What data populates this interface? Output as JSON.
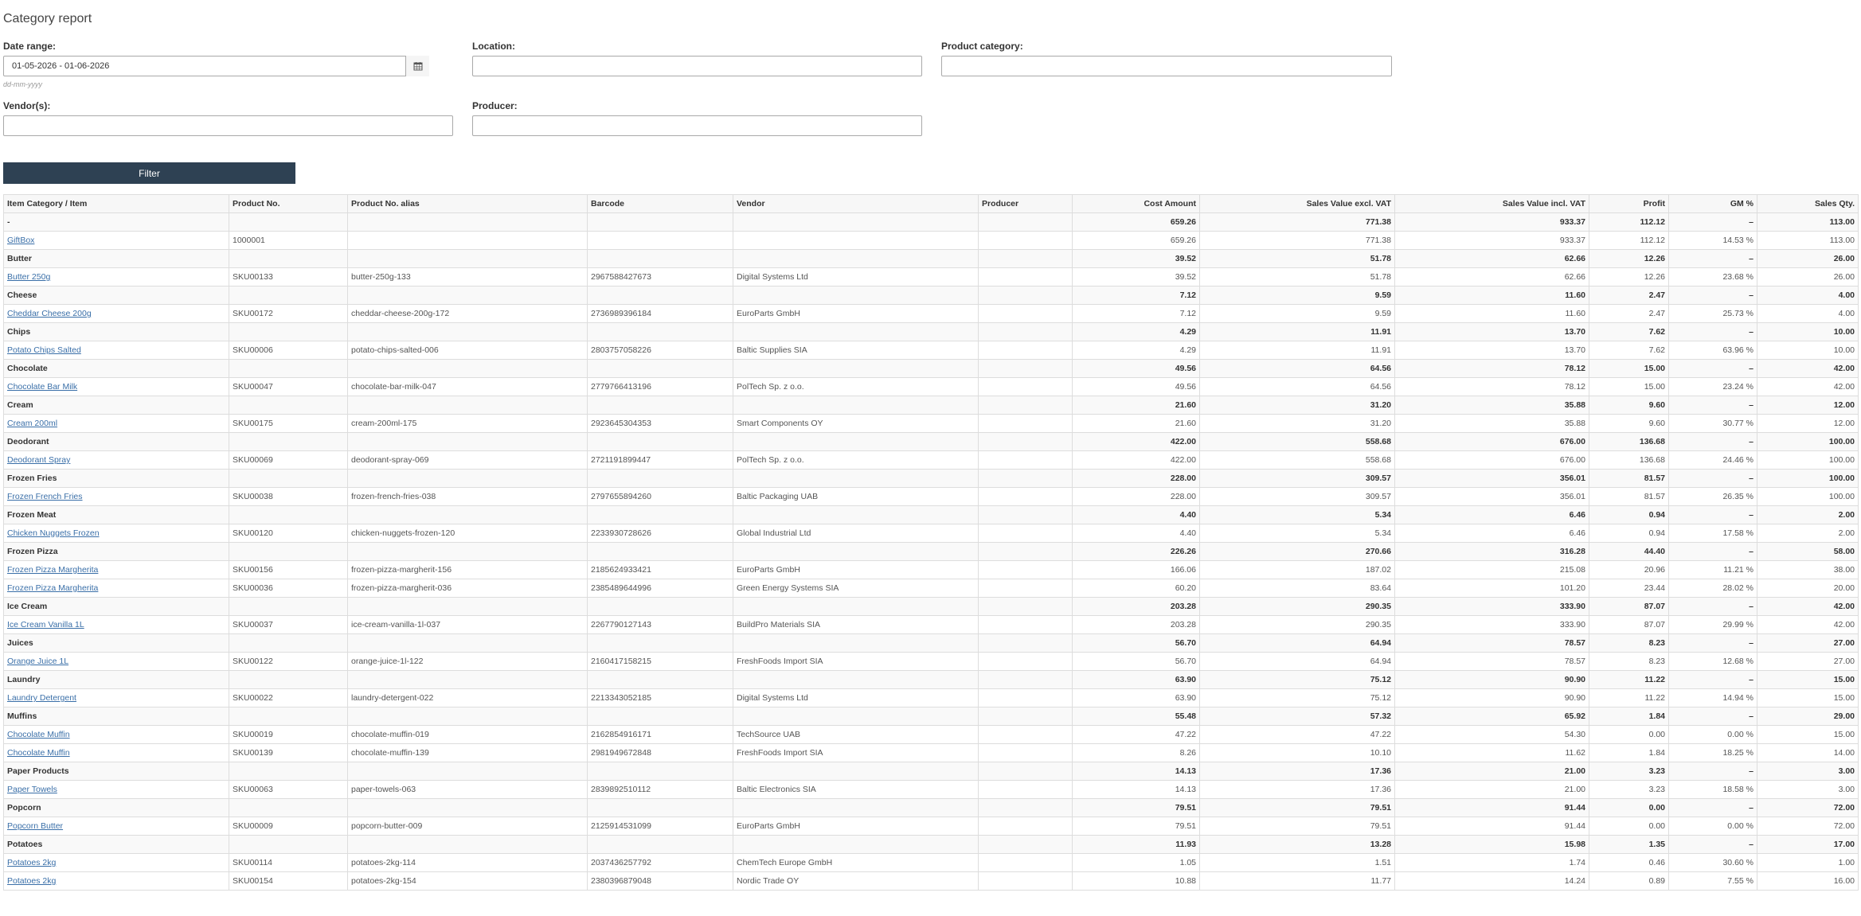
{
  "page": {
    "title": "Category report"
  },
  "filters": {
    "date_range": {
      "label": "Date range:",
      "value": "01-05-2026 - 01-06-2026",
      "hint": "dd-mm-yyyy"
    },
    "location": {
      "label": "Location:",
      "value": ""
    },
    "product_category": {
      "label": "Product category:",
      "value": ""
    },
    "vendors": {
      "label": "Vendor(s):",
      "value": ""
    },
    "producer": {
      "label": "Producer:",
      "value": ""
    },
    "filter_button": "Filter"
  },
  "table": {
    "columns": [
      "Item Category / Item",
      "Product No.",
      "Product No. alias",
      "Barcode",
      "Vendor",
      "Producer",
      "Cost Amount",
      "Sales Value excl. VAT",
      "Sales Value incl. VAT",
      "Profit",
      "GM %",
      "Sales Qty."
    ],
    "rows": [
      {
        "type": "category",
        "cells": [
          "-",
          "",
          "",
          "",
          "",
          "",
          "659.26",
          "771.38",
          "933.37",
          "112.12",
          "–",
          "113.00"
        ]
      },
      {
        "type": "item",
        "cells": [
          "GiftBox",
          "1000001",
          "",
          "",
          "",
          "",
          "659.26",
          "771.38",
          "933.37",
          "112.12",
          "14.53 %",
          "113.00"
        ]
      },
      {
        "type": "category",
        "cells": [
          "Butter",
          "",
          "",
          "",
          "",
          "",
          "39.52",
          "51.78",
          "62.66",
          "12.26",
          "–",
          "26.00"
        ]
      },
      {
        "type": "item",
        "cells": [
          "Butter 250g",
          "SKU00133",
          "butter-250g-133",
          "2967588427673",
          "Digital Systems Ltd",
          "",
          "39.52",
          "51.78",
          "62.66",
          "12.26",
          "23.68 %",
          "26.00"
        ]
      },
      {
        "type": "category",
        "cells": [
          "Cheese",
          "",
          "",
          "",
          "",
          "",
          "7.12",
          "9.59",
          "11.60",
          "2.47",
          "–",
          "4.00"
        ]
      },
      {
        "type": "item",
        "cells": [
          "Cheddar Cheese 200g",
          "SKU00172",
          "cheddar-cheese-200g-172",
          "2736989396184",
          "EuroParts GmbH",
          "",
          "7.12",
          "9.59",
          "11.60",
          "2.47",
          "25.73 %",
          "4.00"
        ]
      },
      {
        "type": "category",
        "cells": [
          "Chips",
          "",
          "",
          "",
          "",
          "",
          "4.29",
          "11.91",
          "13.70",
          "7.62",
          "–",
          "10.00"
        ]
      },
      {
        "type": "item",
        "cells": [
          "Potato Chips Salted",
          "SKU00006",
          "potato-chips-salted-006",
          "2803757058226",
          "Baltic Supplies SIA",
          "",
          "4.29",
          "11.91",
          "13.70",
          "7.62",
          "63.96 %",
          "10.00"
        ]
      },
      {
        "type": "category",
        "cells": [
          "Chocolate",
          "",
          "",
          "",
          "",
          "",
          "49.56",
          "64.56",
          "78.12",
          "15.00",
          "–",
          "42.00"
        ]
      },
      {
        "type": "item",
        "cells": [
          "Chocolate Bar Milk",
          "SKU00047",
          "chocolate-bar-milk-047",
          "2779766413196",
          "PolTech Sp. z o.o.",
          "",
          "49.56",
          "64.56",
          "78.12",
          "15.00",
          "23.24 %",
          "42.00"
        ]
      },
      {
        "type": "category",
        "cells": [
          "Cream",
          "",
          "",
          "",
          "",
          "",
          "21.60",
          "31.20",
          "35.88",
          "9.60",
          "–",
          "12.00"
        ]
      },
      {
        "type": "item",
        "cells": [
          "Cream 200ml",
          "SKU00175",
          "cream-200ml-175",
          "2923645304353",
          "Smart Components OY",
          "",
          "21.60",
          "31.20",
          "35.88",
          "9.60",
          "30.77 %",
          "12.00"
        ]
      },
      {
        "type": "category",
        "cells": [
          "Deodorant",
          "",
          "",
          "",
          "",
          "",
          "422.00",
          "558.68",
          "676.00",
          "136.68",
          "–",
          "100.00"
        ]
      },
      {
        "type": "item",
        "cells": [
          "Deodorant Spray",
          "SKU00069",
          "deodorant-spray-069",
          "2721191899447",
          "PolTech Sp. z o.o.",
          "",
          "422.00",
          "558.68",
          "676.00",
          "136.68",
          "24.46 %",
          "100.00"
        ]
      },
      {
        "type": "category",
        "cells": [
          "Frozen Fries",
          "",
          "",
          "",
          "",
          "",
          "228.00",
          "309.57",
          "356.01",
          "81.57",
          "–",
          "100.00"
        ]
      },
      {
        "type": "item",
        "cells": [
          "Frozen French Fries",
          "SKU00038",
          "frozen-french-fries-038",
          "2797655894260",
          "Baltic Packaging UAB",
          "",
          "228.00",
          "309.57",
          "356.01",
          "81.57",
          "26.35 %",
          "100.00"
        ]
      },
      {
        "type": "category",
        "cells": [
          "Frozen Meat",
          "",
          "",
          "",
          "",
          "",
          "4.40",
          "5.34",
          "6.46",
          "0.94",
          "–",
          "2.00"
        ]
      },
      {
        "type": "item",
        "cells": [
          "Chicken Nuggets Frozen",
          "SKU00120",
          "chicken-nuggets-frozen-120",
          "2233930728626",
          "Global Industrial Ltd",
          "",
          "4.40",
          "5.34",
          "6.46",
          "0.94",
          "17.58 %",
          "2.00"
        ]
      },
      {
        "type": "category",
        "cells": [
          "Frozen Pizza",
          "",
          "",
          "",
          "",
          "",
          "226.26",
          "270.66",
          "316.28",
          "44.40",
          "–",
          "58.00"
        ]
      },
      {
        "type": "item",
        "cells": [
          "Frozen Pizza Margherita",
          "SKU00156",
          "frozen-pizza-margherit-156",
          "2185624933421",
          "EuroParts GmbH",
          "",
          "166.06",
          "187.02",
          "215.08",
          "20.96",
          "11.21 %",
          "38.00"
        ]
      },
      {
        "type": "item",
        "cells": [
          "Frozen Pizza Margherita",
          "SKU00036",
          "frozen-pizza-margherit-036",
          "2385489644996",
          "Green Energy Systems SIA",
          "",
          "60.20",
          "83.64",
          "101.20",
          "23.44",
          "28.02 %",
          "20.00"
        ]
      },
      {
        "type": "category",
        "cells": [
          "Ice Cream",
          "",
          "",
          "",
          "",
          "",
          "203.28",
          "290.35",
          "333.90",
          "87.07",
          "–",
          "42.00"
        ]
      },
      {
        "type": "item",
        "cells": [
          "Ice Cream Vanilla 1L",
          "SKU00037",
          "ice-cream-vanilla-1l-037",
          "2267790127143",
          "BuildPro Materials SIA",
          "",
          "203.28",
          "290.35",
          "333.90",
          "87.07",
          "29.99 %",
          "42.00"
        ]
      },
      {
        "type": "category",
        "cells": [
          "Juices",
          "",
          "",
          "",
          "",
          "",
          "56.70",
          "64.94",
          "78.57",
          "8.23",
          "–",
          "27.00"
        ]
      },
      {
        "type": "item",
        "cells": [
          "Orange Juice 1L",
          "SKU00122",
          "orange-juice-1l-122",
          "2160417158215",
          "FreshFoods Import SIA",
          "",
          "56.70",
          "64.94",
          "78.57",
          "8.23",
          "12.68 %",
          "27.00"
        ]
      },
      {
        "type": "category",
        "cells": [
          "Laundry",
          "",
          "",
          "",
          "",
          "",
          "63.90",
          "75.12",
          "90.90",
          "11.22",
          "–",
          "15.00"
        ]
      },
      {
        "type": "item",
        "cells": [
          "Laundry Detergent",
          "SKU00022",
          "laundry-detergent-022",
          "2213343052185",
          "Digital Systems Ltd",
          "",
          "63.90",
          "75.12",
          "90.90",
          "11.22",
          "14.94 %",
          "15.00"
        ]
      },
      {
        "type": "category",
        "cells": [
          "Muffins",
          "",
          "",
          "",
          "",
          "",
          "55.48",
          "57.32",
          "65.92",
          "1.84",
          "–",
          "29.00"
        ]
      },
      {
        "type": "item",
        "cells": [
          "Chocolate Muffin",
          "SKU00019",
          "chocolate-muffin-019",
          "2162854916171",
          "TechSource UAB",
          "",
          "47.22",
          "47.22",
          "54.30",
          "0.00",
          "0.00 %",
          "15.00"
        ]
      },
      {
        "type": "item",
        "cells": [
          "Chocolate Muffin",
          "SKU00139",
          "chocolate-muffin-139",
          "2981949672848",
          "FreshFoods Import SIA",
          "",
          "8.26",
          "10.10",
          "11.62",
          "1.84",
          "18.25 %",
          "14.00"
        ]
      },
      {
        "type": "category",
        "cells": [
          "Paper Products",
          "",
          "",
          "",
          "",
          "",
          "14.13",
          "17.36",
          "21.00",
          "3.23",
          "–",
          "3.00"
        ]
      },
      {
        "type": "item",
        "cells": [
          "Paper Towels",
          "SKU00063",
          "paper-towels-063",
          "2839892510112",
          "Baltic Electronics SIA",
          "",
          "14.13",
          "17.36",
          "21.00",
          "3.23",
          "18.58 %",
          "3.00"
        ]
      },
      {
        "type": "category",
        "cells": [
          "Popcorn",
          "",
          "",
          "",
          "",
          "",
          "79.51",
          "79.51",
          "91.44",
          "0.00",
          "–",
          "72.00"
        ]
      },
      {
        "type": "item",
        "cells": [
          "Popcorn Butter",
          "SKU00009",
          "popcorn-butter-009",
          "2125914531099",
          "EuroParts GmbH",
          "",
          "79.51",
          "79.51",
          "91.44",
          "0.00",
          "0.00 %",
          "72.00"
        ]
      },
      {
        "type": "category",
        "cells": [
          "Potatoes",
          "",
          "",
          "",
          "",
          "",
          "11.93",
          "13.28",
          "15.98",
          "1.35",
          "–",
          "17.00"
        ]
      },
      {
        "type": "item",
        "cells": [
          "Potatoes 2kg",
          "SKU00114",
          "potatoes-2kg-114",
          "2037436257792",
          "ChemTech Europe GmbH",
          "",
          "1.05",
          "1.51",
          "1.74",
          "0.46",
          "30.60 %",
          "1.00"
        ]
      },
      {
        "type": "item",
        "cells": [
          "Potatoes 2kg",
          "SKU00154",
          "potatoes-2kg-154",
          "2380396879048",
          "Nordic Trade OY",
          "",
          "10.88",
          "11.77",
          "14.24",
          "0.89",
          "7.55 %",
          "16.00"
        ]
      }
    ]
  }
}
